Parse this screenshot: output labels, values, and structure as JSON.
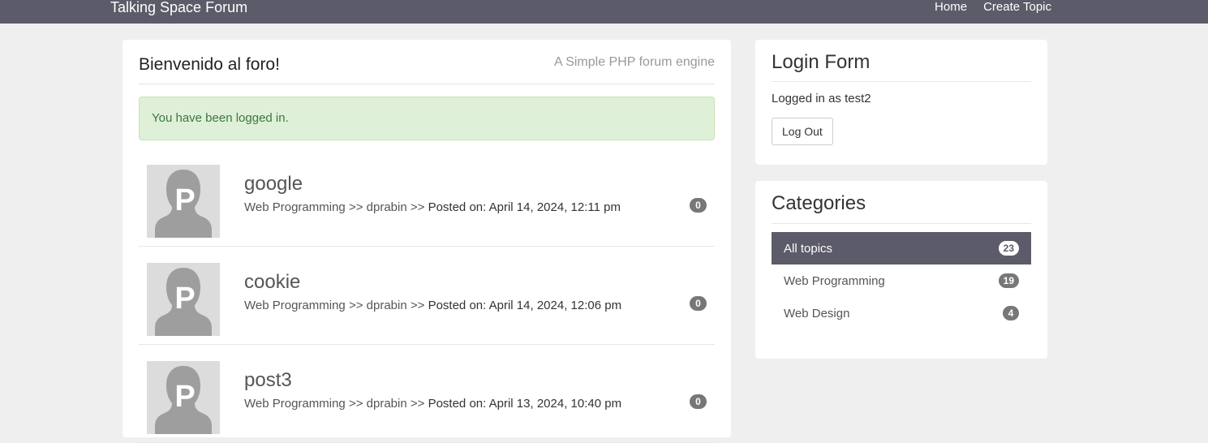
{
  "nav": {
    "brand": "Talking Space Forum",
    "links": [
      "Home",
      "Create Topic"
    ]
  },
  "main": {
    "title": "Bienvenido al foro!",
    "subtitle": "A Simple PHP forum engine",
    "alert": "You have been logged in.",
    "topics": [
      {
        "title": "google",
        "category": "Web Programming",
        "author": "dprabin",
        "posted": "Posted on: April 14, 2024, 12:11 pm",
        "count": "0",
        "avatar_letter": "P"
      },
      {
        "title": "cookie",
        "category": "Web Programming",
        "author": "dprabin",
        "posted": "Posted on: April 14, 2024, 12:06 pm",
        "count": "0",
        "avatar_letter": "P"
      },
      {
        "title": "post3",
        "category": "Web Programming",
        "author": "dprabin",
        "posted": "Posted on: April 13, 2024, 10:40 pm",
        "count": "0",
        "avatar_letter": "P"
      }
    ],
    "separator": ">>"
  },
  "login": {
    "title": "Login Form",
    "status": "Logged in as test2",
    "logout_label": "Log Out"
  },
  "categories": {
    "title": "Categories",
    "items": [
      {
        "label": "All topics",
        "count": "23",
        "active": true
      },
      {
        "label": "Web Programming",
        "count": "19",
        "active": false
      },
      {
        "label": "Web Design",
        "count": "4",
        "active": false
      }
    ]
  },
  "colors": {
    "navbar": "#5c5b69",
    "alert_bg": "#dff0d8",
    "alert_text": "#3c763d",
    "badge": "#777777"
  }
}
